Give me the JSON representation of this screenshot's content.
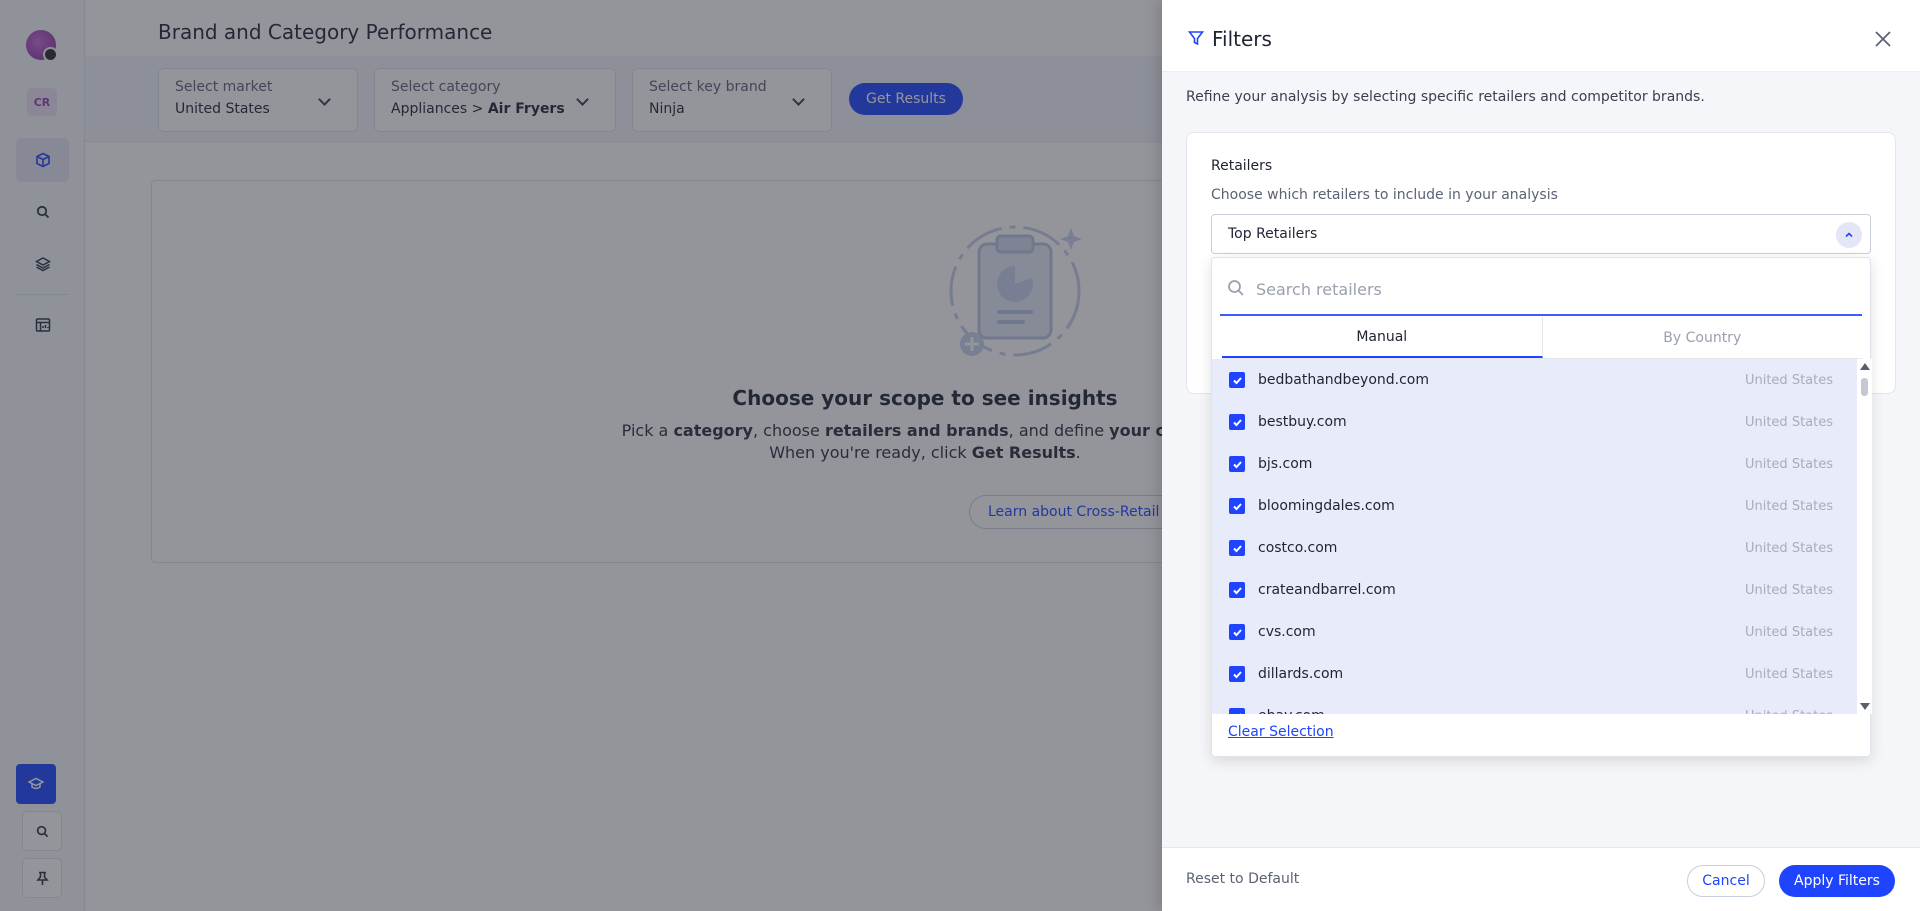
{
  "rail": {
    "badge": "CR",
    "icons": [
      "cube-icon",
      "search-icon",
      "layers-icon",
      "dashboard-icon"
    ],
    "bottom_icons": [
      "graduation-cap-icon",
      "search-icon",
      "pin-icon"
    ],
    "accent": "#1f44ff"
  },
  "page": {
    "title": "Brand and Category Performance"
  },
  "selectors": {
    "market": {
      "label": "Select market",
      "value": "United States"
    },
    "category": {
      "label": "Select category",
      "value_prefix": "Appliances > ",
      "value_bold": "Air Fryers"
    },
    "brand": {
      "label": "Select key brand",
      "value": "Ninja"
    },
    "get_results": "Get Results"
  },
  "empty_state": {
    "title": "Choose your scope to see insights",
    "line1_a": "Pick a ",
    "line1_b": "category",
    "line1_c": ", choose ",
    "line1_d": "retailers and brands",
    "line1_e": ", and define ",
    "line1_f": "your own bra",
    "line2_a": "When you're ready, click ",
    "line2_b": "Get Results",
    "line2_c": ".",
    "learn_button": "Learn about Cross-Retail IQ"
  },
  "filters": {
    "title": "Filters",
    "description": "Refine your analysis by selecting specific retailers and competitor brands.",
    "retailers": {
      "title": "Retailers",
      "subtitle": "Choose which retailers to include in your analysis",
      "selected": "Top Retailers",
      "search_placeholder": "Search retailers",
      "tabs": [
        "Manual",
        "By Country"
      ],
      "active_tab": "Manual",
      "items": [
        {
          "name": "bedbathandbeyond.com",
          "country": "United States",
          "checked": true
        },
        {
          "name": "bestbuy.com",
          "country": "United States",
          "checked": true
        },
        {
          "name": "bjs.com",
          "country": "United States",
          "checked": true
        },
        {
          "name": "bloomingdales.com",
          "country": "United States",
          "checked": true
        },
        {
          "name": "costco.com",
          "country": "United States",
          "checked": true
        },
        {
          "name": "crateandbarrel.com",
          "country": "United States",
          "checked": true
        },
        {
          "name": "cvs.com",
          "country": "United States",
          "checked": true
        },
        {
          "name": "dillards.com",
          "country": "United States",
          "checked": true
        },
        {
          "name": "ebay.com",
          "country": "United States",
          "checked": true
        }
      ],
      "clear_selection": "Clear Selection"
    },
    "footer": {
      "reset": "Reset to Default",
      "cancel": "Cancel",
      "apply": "Apply Filters"
    }
  }
}
